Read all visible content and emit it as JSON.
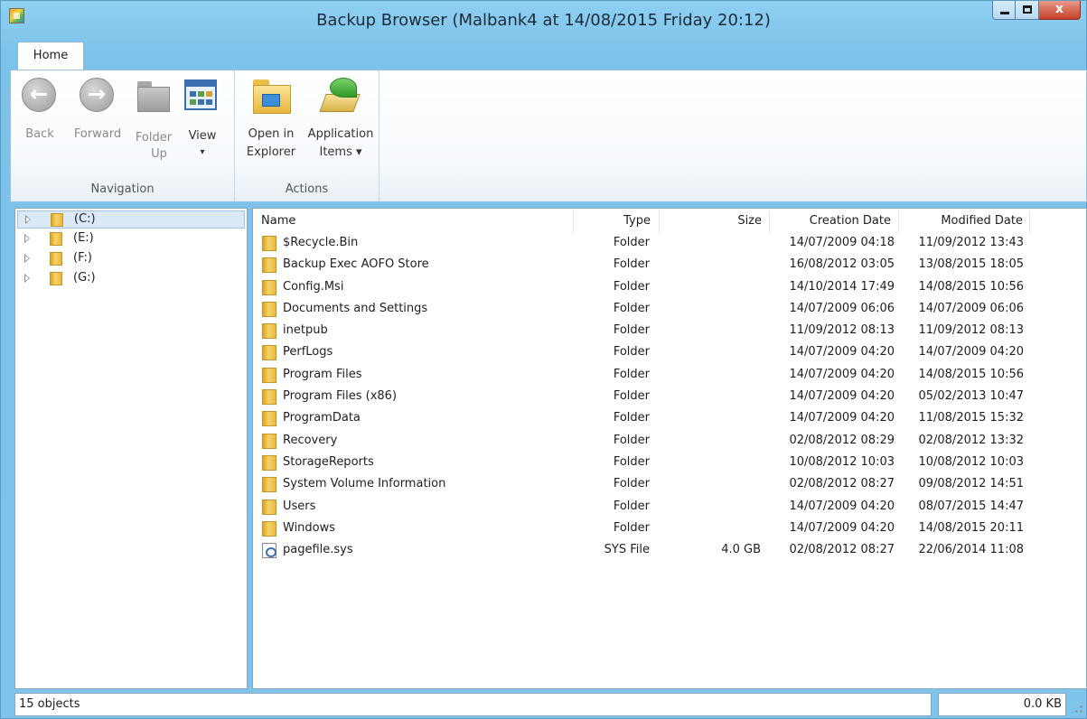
{
  "window": {
    "title": "Backup Browser (Malbank4 at 14/08/2015 Friday 20:12)",
    "close_glyph": "x"
  },
  "ribbon": {
    "tabs": [
      {
        "label": "Home",
        "active": true
      }
    ],
    "groups": {
      "navigation": {
        "label": "Navigation",
        "back": {
          "label": "Back",
          "icon": "back-arrow-icon",
          "enabled": false
        },
        "forward": {
          "label": "Forward",
          "icon": "forward-arrow-icon",
          "enabled": false
        },
        "folder_up_1": "Folder",
        "folder_up_2": "Up",
        "view_1": "View",
        "view_2": "▾"
      },
      "actions": {
        "label": "Actions",
        "open_in_explorer_1": "Open in",
        "open_in_explorer_2": "Explorer",
        "application_items_1": "Application",
        "application_items_2": "Items ▾"
      }
    }
  },
  "tree": {
    "items": [
      {
        "label": "(C:)",
        "selected": true
      },
      {
        "label": "(E:)",
        "selected": false
      },
      {
        "label": "(F:)",
        "selected": false
      },
      {
        "label": "(G:)",
        "selected": false
      }
    ]
  },
  "list": {
    "columns": {
      "name": "Name",
      "type": "Type",
      "size": "Size",
      "created": "Creation Date",
      "modified": "Modified Date"
    },
    "rows": [
      {
        "icon": "folder",
        "name": "$Recycle.Bin",
        "type": "Folder",
        "size": "",
        "created": "14/07/2009 04:18",
        "modified": "11/09/2012 13:43"
      },
      {
        "icon": "folder",
        "name": "Backup Exec AOFO Store",
        "type": "Folder",
        "size": "",
        "created": "16/08/2012 03:05",
        "modified": "13/08/2015 18:05"
      },
      {
        "icon": "folder",
        "name": "Config.Msi",
        "type": "Folder",
        "size": "",
        "created": "14/10/2014 17:49",
        "modified": "14/08/2015 10:56"
      },
      {
        "icon": "folder",
        "name": "Documents and Settings",
        "type": "Folder",
        "size": "",
        "created": "14/07/2009 06:06",
        "modified": "14/07/2009 06:06"
      },
      {
        "icon": "folder",
        "name": "inetpub",
        "type": "Folder",
        "size": "",
        "created": "11/09/2012 08:13",
        "modified": "11/09/2012 08:13"
      },
      {
        "icon": "folder",
        "name": "PerfLogs",
        "type": "Folder",
        "size": "",
        "created": "14/07/2009 04:20",
        "modified": "14/07/2009 04:20"
      },
      {
        "icon": "folder",
        "name": "Program Files",
        "type": "Folder",
        "size": "",
        "created": "14/07/2009 04:20",
        "modified": "14/08/2015 10:56"
      },
      {
        "icon": "folder",
        "name": "Program Files (x86)",
        "type": "Folder",
        "size": "",
        "created": "14/07/2009 04:20",
        "modified": "05/02/2013 10:47"
      },
      {
        "icon": "folder",
        "name": "ProgramData",
        "type": "Folder",
        "size": "",
        "created": "14/07/2009 04:20",
        "modified": "11/08/2015 15:32"
      },
      {
        "icon": "folder",
        "name": "Recovery",
        "type": "Folder",
        "size": "",
        "created": "02/08/2012 08:29",
        "modified": "02/08/2012 13:32"
      },
      {
        "icon": "folder",
        "name": "StorageReports",
        "type": "Folder",
        "size": "",
        "created": "10/08/2012 10:03",
        "modified": "10/08/2012 10:03"
      },
      {
        "icon": "folder",
        "name": "System Volume Information",
        "type": "Folder",
        "size": "",
        "created": "02/08/2012 08:27",
        "modified": "09/08/2012 14:51"
      },
      {
        "icon": "folder",
        "name": "Users",
        "type": "Folder",
        "size": "",
        "created": "14/07/2009 04:20",
        "modified": "08/07/2015 14:47"
      },
      {
        "icon": "folder",
        "name": "Windows",
        "type": "Folder",
        "size": "",
        "created": "14/07/2009 04:20",
        "modified": "14/08/2015 20:11"
      },
      {
        "icon": "file",
        "name": "pagefile.sys",
        "type": "SYS File",
        "size": "4.0 GB",
        "created": "02/08/2012 08:27",
        "modified": "22/06/2014 11:08"
      }
    ]
  },
  "status": {
    "object_count": "15 objects",
    "size": "0.0 KB"
  }
}
